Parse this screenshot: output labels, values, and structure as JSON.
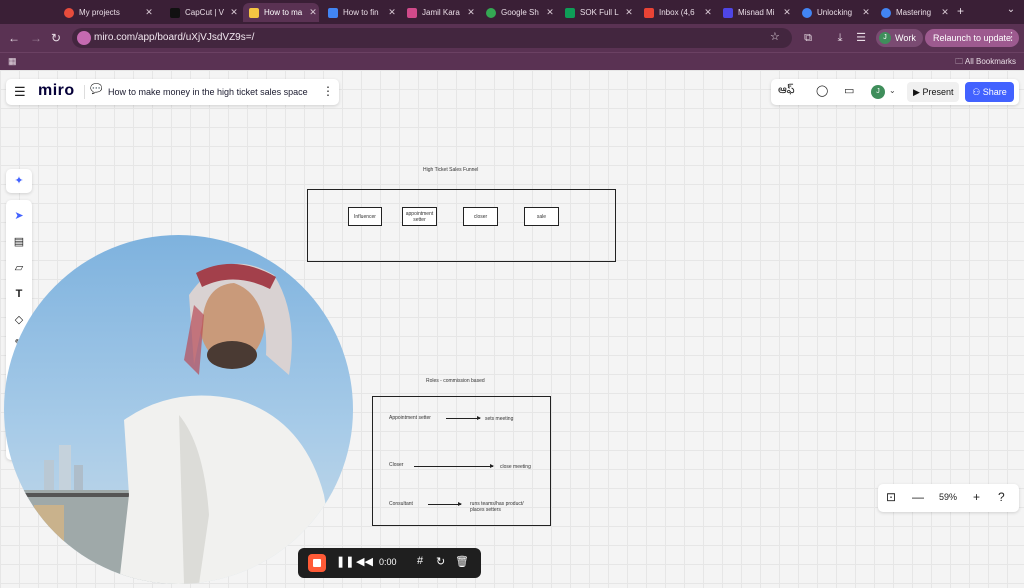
{
  "browser": {
    "tabs": [
      {
        "label": "My projects",
        "favicon_color": "#e74c3c"
      },
      {
        "label": "CapCut | V",
        "favicon_color": "#111111"
      },
      {
        "label": "How to ma",
        "favicon_color": "#f5c542",
        "active": true
      },
      {
        "label": "How to fin",
        "favicon_color": "#4285f4"
      },
      {
        "label": "Jamil Kara",
        "favicon_color": "#d04a8a"
      },
      {
        "label": "Google Sh",
        "favicon_color": "#34a853"
      },
      {
        "label": "SOK Full L",
        "favicon_color": "#0f9d58"
      },
      {
        "label": "Inbox (4,6",
        "favicon_color": "#ea4335"
      },
      {
        "label": "Misnad Mi",
        "favicon_color": "#4f46e5"
      },
      {
        "label": "Unlocking",
        "favicon_color": "#4285f4"
      },
      {
        "label": "Mastering",
        "favicon_color": "#4285f4"
      }
    ],
    "new_tab": "+",
    "url": "miro.com/app/board/uXjVJsdVZ9s=/",
    "profile": {
      "initial": "J",
      "name": "Work"
    },
    "relaunch": "Relaunch to update",
    "bookmarks_label": "All Bookmarks"
  },
  "board": {
    "logo": "miro",
    "title": "How to make money in the high ticket sales space",
    "avatar_initial": "J",
    "present_label": "Present",
    "share_label": "Share"
  },
  "funnel": {
    "title": "High Ticket Sales Funnel",
    "nodes": [
      "Influencer",
      "appointment setter",
      "closer",
      "sale"
    ]
  },
  "roles": {
    "title": "Roles - commission based",
    "rows": [
      {
        "role": "Appointment setter",
        "action": "sets meeting"
      },
      {
        "role": "Closer",
        "action": "close meeting"
      },
      {
        "role": "Consultant",
        "action": "runs teams/has product/ places setters"
      }
    ]
  },
  "recording": {
    "time": "0:00"
  },
  "zoom": {
    "level": "59%"
  },
  "colors": {
    "accent": "#4262ff",
    "browser_frame": "#5a3253",
    "record": "#ff5a36"
  }
}
